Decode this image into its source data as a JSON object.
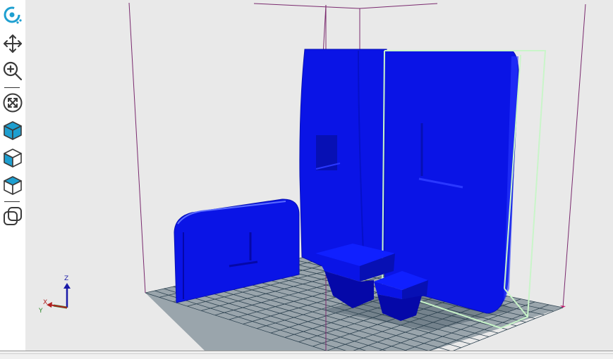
{
  "toolbar": {
    "tools": [
      {
        "name": "rotate-view-icon",
        "active": true
      },
      {
        "name": "move-icon"
      },
      {
        "name": "zoom-icon"
      },
      {
        "name": "fit-view-icon"
      },
      {
        "name": "iso-view-icon"
      },
      {
        "name": "front-view-icon"
      },
      {
        "name": "top-view-icon"
      },
      {
        "name": "reset-view-icon"
      }
    ]
  },
  "axes_gizmo": {
    "x": "X",
    "y": "Y",
    "z": "Z"
  },
  "colors": {
    "viewport_bg": "#e9e9e9",
    "model_blue": "#0a14e6",
    "model_blue_dark": "#0710b4",
    "bed_grid": "#9aa5ac",
    "bed_lines": "#2d4250",
    "build_volume": "#7a2a6e",
    "selection_box": "#c9f5c9",
    "tool_accent": "#1e9fd0"
  }
}
